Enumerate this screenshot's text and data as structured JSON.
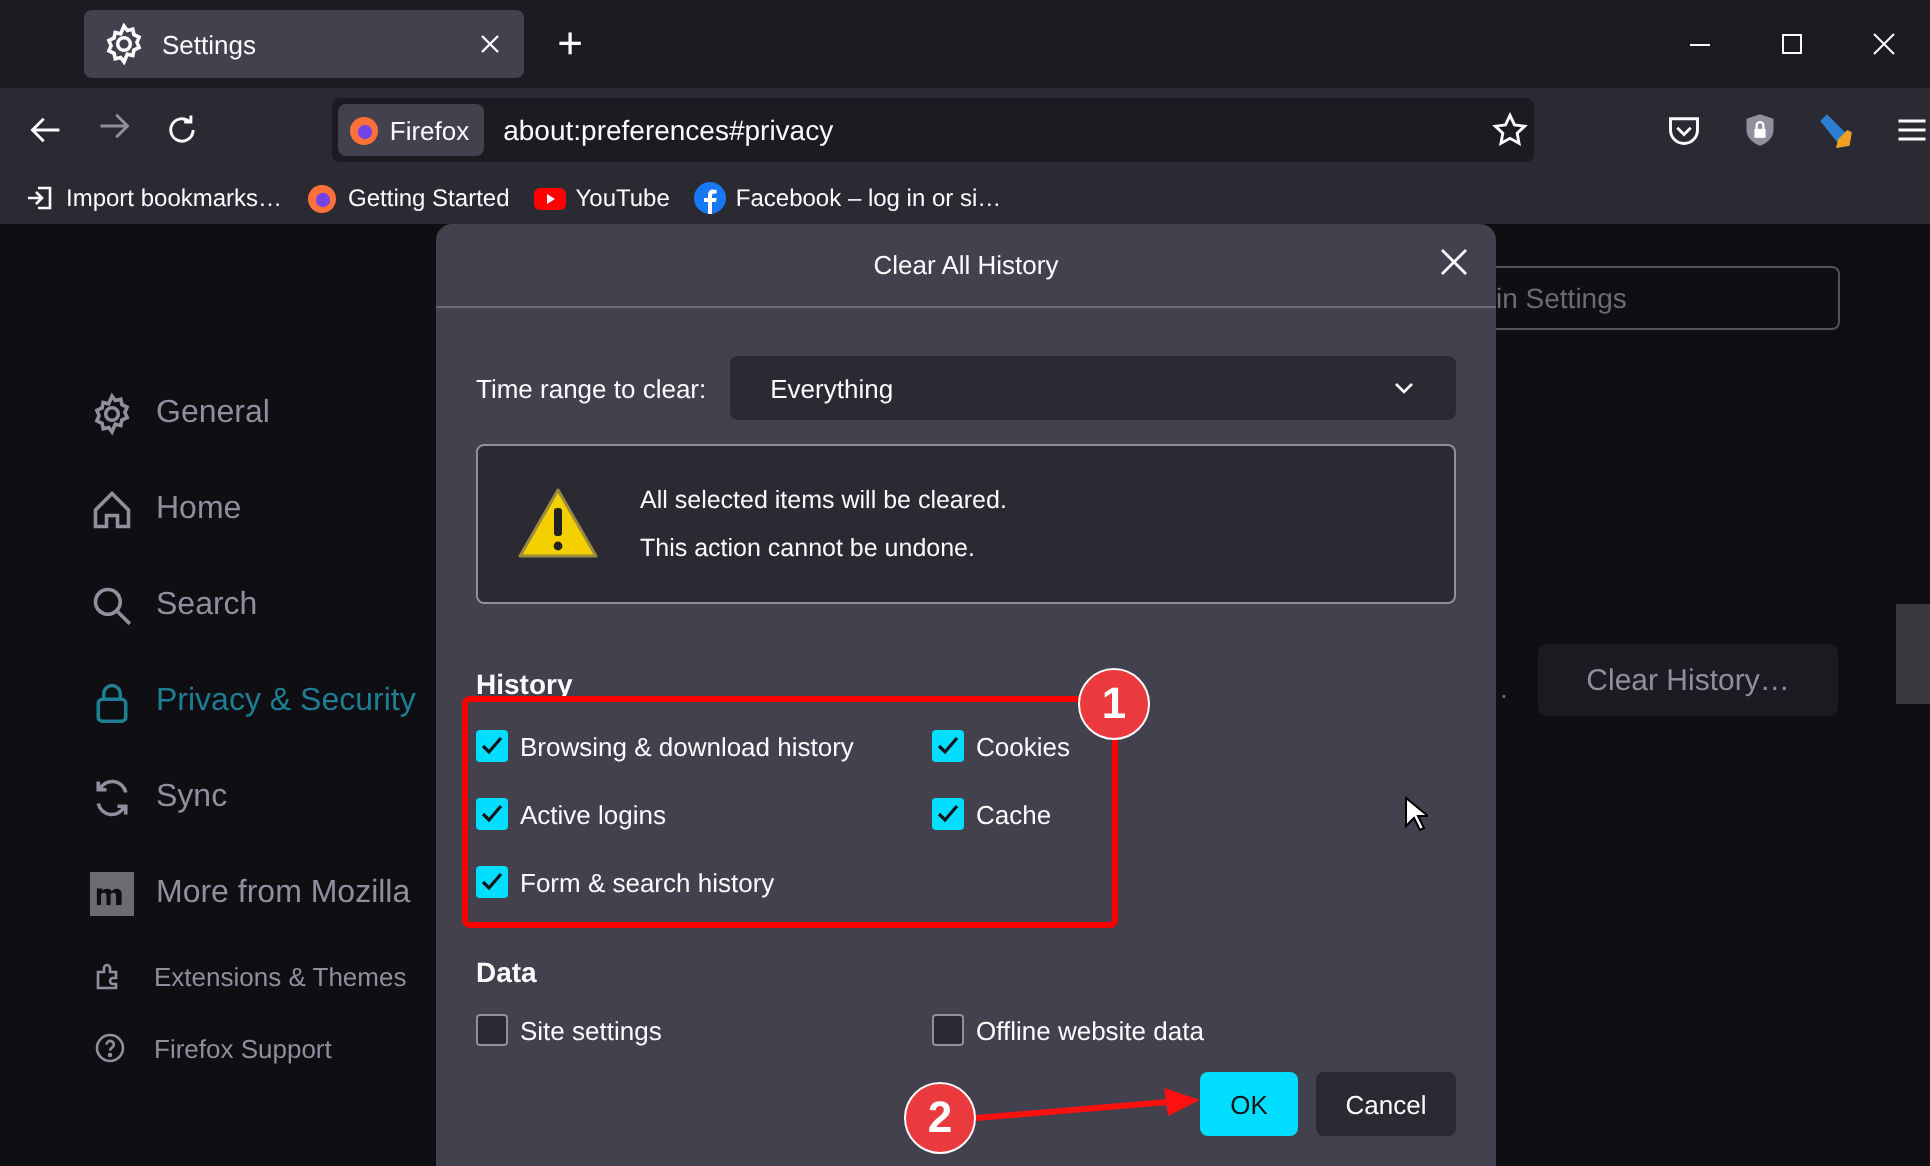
{
  "browser": {
    "tab": {
      "title": "Settings",
      "selected": true
    },
    "new_tab": "+",
    "address_bar": {
      "identity": "Firefox",
      "url": "about:preferences#privacy"
    },
    "bookmarks": [
      {
        "label": "Import bookmarks…"
      },
      {
        "label": "Getting Started"
      },
      {
        "label": "YouTube"
      },
      {
        "label": "Facebook – log in or si…"
      }
    ]
  },
  "sidebar": {
    "items": [
      {
        "label": "General",
        "selected": false
      },
      {
        "label": "Home",
        "selected": false
      },
      {
        "label": "Search",
        "selected": false
      },
      {
        "label": "Privacy & Security",
        "selected": true
      },
      {
        "label": "Sync",
        "selected": false
      },
      {
        "label": "More from Mozilla",
        "selected": false
      }
    ],
    "footer_items": [
      {
        "label": "Extensions & Themes"
      },
      {
        "label": "Firefox Support"
      }
    ]
  },
  "settings_search": {
    "placeholder": "in Settings"
  },
  "history_section": {
    "text_fragment": ".",
    "clear_history_button": "Clear History…"
  },
  "dialog": {
    "title": "Clear All History",
    "time_range": {
      "label": "Time range to clear:",
      "value": "Everything"
    },
    "warning": [
      "All selected items will be cleared.",
      "This action cannot be undone."
    ],
    "history": {
      "heading": "History",
      "items": [
        {
          "label": "Browsing & download history",
          "checked": true
        },
        {
          "label": "Cookies",
          "checked": true
        },
        {
          "label": "Active logins",
          "checked": true
        },
        {
          "label": "Cache",
          "checked": true
        },
        {
          "label": "Form & search history",
          "checked": true
        }
      ]
    },
    "data": {
      "heading": "Data",
      "items": [
        {
          "label": "Site settings",
          "checked": false
        },
        {
          "label": "Offline website data",
          "checked": false
        }
      ]
    },
    "buttons": [
      {
        "label": "OK",
        "kind": "primary"
      },
      {
        "label": "Cancel",
        "kind": "secondary"
      }
    ]
  },
  "annotations": [
    {
      "label": "1"
    },
    {
      "label": "2"
    }
  ]
}
